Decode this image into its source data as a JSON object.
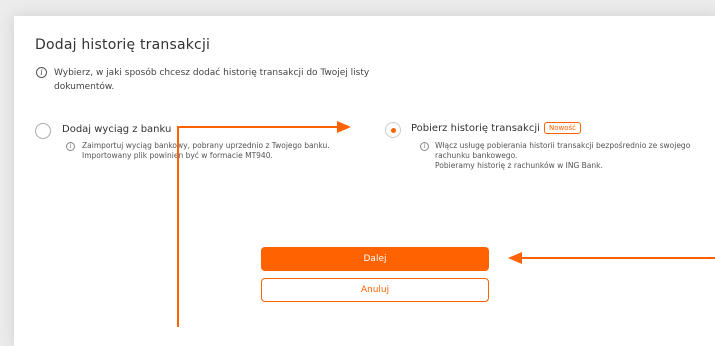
{
  "dialog": {
    "title": "Dodaj historię transakcji",
    "info_glyph": "i",
    "subtitle": "Wybierz, w jaki sposób chcesz dodać historię transakcji do Twojej listy dokumentów."
  },
  "options": [
    {
      "label": "Dodaj wyciąg z banku",
      "selected": false,
      "description": "Zaimportuj wyciąg bankowy, pobrany uprzednio z Twojego banku. Importowany plik powinien być w formacie MT940."
    },
    {
      "label": "Pobierz historię transakcji",
      "selected": true,
      "badge": "Nowość",
      "description_1": "Włącz usługę pobierania historii transakcji bezpośrednio ze swojego rachunku bankowego.",
      "description_2": "Pobieramy historię z rachunków w ING Bank."
    }
  ],
  "buttons": {
    "primary": "Dalej",
    "secondary": "Anuluj"
  },
  "colors": {
    "accent": "#ff6200"
  }
}
